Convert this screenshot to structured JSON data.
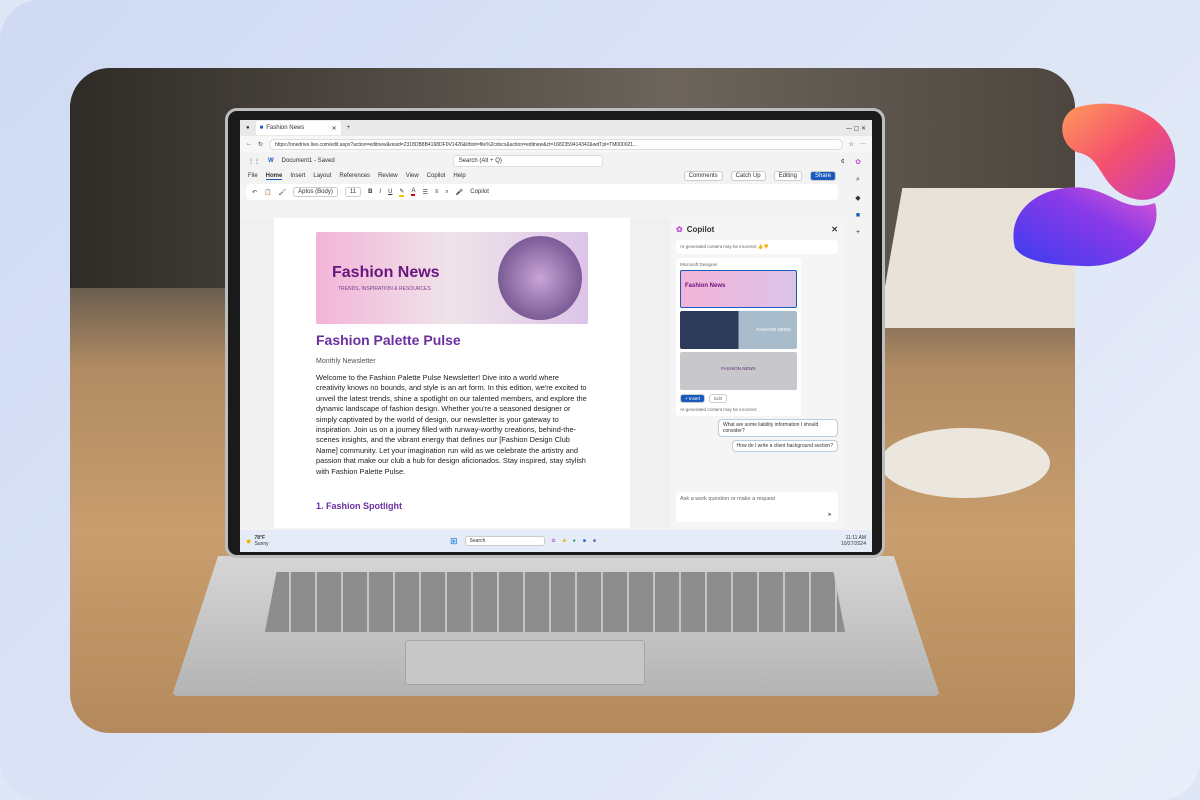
{
  "browser": {
    "tab_title": "Fashion News",
    "url": "https://onedrive.live.com/edit.aspx?action=editnew&resid=2318DB8B4168DF0V1426&ithint=file%2cdocx&action=editnew&ct=1682359414342&wdTpl=TM000021..."
  },
  "word": {
    "doc_name": "Document1 - Saved",
    "search_placeholder": "Search (Alt + Q)",
    "menus": [
      "File",
      "Home",
      "Insert",
      "Layout",
      "References",
      "Review",
      "View",
      "Copilot",
      "Help"
    ],
    "comments": "Comments",
    "catchup": "Catch Up",
    "editing": "Editing",
    "share": "Share",
    "font": "Aptos (Body)",
    "size": "11",
    "copilot_btn": "Copilot"
  },
  "document": {
    "banner_title": "Fashion News",
    "banner_sub": "TRENDS, INSPIRATION & RESOURCES",
    "title": "Fashion Palette Pulse",
    "subtitle": "Monthly Newsletter",
    "body": "Welcome to the Fashion Palette Pulse Newsletter! Dive into a world where creativity knows no bounds, and style is an art form. In this edition, we're excited to unveil the latest trends, shine a spotlight on our talented members, and explore the dynamic landscape of fashion design. Whether you're a seasoned designer or simply captivated by the world of design, our newsletter is your gateway to inspiration. Join us on a journey filled with runway-worthy creations, behind-the-scenes insights, and the vibrant energy that defines our [Fashion Design Club Name] community. Let your imagination run wild as we celebrate the artistry and passion that make our club a hub for design aficionados. Stay inspired, stay stylish with Fashion Palette Pulse.",
    "heading1": "1. Fashion Spotlight"
  },
  "copilot": {
    "title": "Copilot",
    "disclaimer": "AI-generated content may be incorrect",
    "designer": "Microsoft Designer",
    "thumb_banner": "Fashion News",
    "thumb2": "FASHION NEWS",
    "thumb3": "FASHION NEWS",
    "insert": "+ Insert",
    "edit": "Edit",
    "suggestions": [
      "What are some liability information I should consider?",
      "How do I write a client background section?"
    ],
    "ask_placeholder": "Ask a work question or make a request"
  },
  "taskbar": {
    "temp": "78°F",
    "weather": "Sunny",
    "search": "Search",
    "time": "11:11 AM",
    "date": "10/27/2024"
  },
  "colors": {
    "accent": "#185abd",
    "title_purple": "#6b2fa0"
  }
}
